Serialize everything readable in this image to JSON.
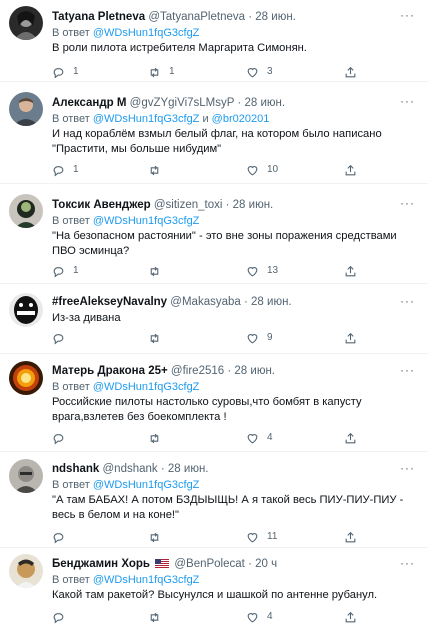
{
  "tweets": [
    {
      "name": "Tatyana Pletneva",
      "handle": "@TatyanaPletneva",
      "dot": "·",
      "time": "28 июн.",
      "reply_prefix": "В ответ ",
      "reply_to": "@WDsHun1fqG3cfgZ",
      "reply_and": "",
      "reply_to2": "",
      "text": "В роли пилота истребителя Маргарита Симонян.",
      "replies": "1",
      "retweets": "1",
      "likes": "3"
    },
    {
      "name": "Александр М",
      "handle": "@gvZYgiVi7sLMsyP",
      "dot": "·",
      "time": "28 июн.",
      "reply_prefix": "В ответ ",
      "reply_to": "@WDsHun1fqG3cfgZ",
      "reply_and": " и ",
      "reply_to2": "@br020201",
      "text": "И над кораблём взмыл белый флаг, на котором было написано \"Прастити, мы больше нибудим\"",
      "replies": "1",
      "retweets": "",
      "likes": "10"
    },
    {
      "name": "Токсик Авенджер",
      "handle": "@sitizen_toxi",
      "dot": "·",
      "time": "28 июн.",
      "reply_prefix": "В ответ ",
      "reply_to": "@WDsHun1fqG3cfgZ",
      "reply_and": "",
      "reply_to2": "",
      "text": "\"На безопасном растоянии\" - это вне зоны поражения средствами ПВО эсминца?",
      "replies": "1",
      "retweets": "",
      "likes": "13"
    },
    {
      "name": "#freeAlekseyNavalny",
      "handle": "@Makasyaba",
      "dot": "·",
      "time": "28 июн.",
      "reply_prefix": "",
      "reply_to": "",
      "reply_and": "",
      "reply_to2": "",
      "text": "Из-за дивана",
      "replies": "",
      "retweets": "",
      "likes": "9"
    },
    {
      "name": "Матерь Дракона 25+",
      "handle": "@fire2516",
      "dot": "·",
      "time": "28 июн.",
      "reply_prefix": "В ответ ",
      "reply_to": "@WDsHun1fqG3cfgZ",
      "reply_and": "",
      "reply_to2": "",
      "text": "Российские пилоты настолько суровы,что бомбят в капусту врага,взлетев без боекомплекта !",
      "replies": "",
      "retweets": "",
      "likes": "4"
    },
    {
      "name": "ndshank",
      "handle": "@ndshank",
      "dot": "·",
      "time": "28 июн.",
      "reply_prefix": "В ответ ",
      "reply_to": "@WDsHun1fqG3cfgZ",
      "reply_and": "",
      "reply_to2": "",
      "text": "\"А там БАБАХ! А потом БЗДЫЫЩЬ! А я такой весь ПИУ-ПИУ-ПИУ - весь в белом и на коне!\"",
      "replies": "",
      "retweets": "",
      "likes": "11"
    },
    {
      "name": "Бенджамин Хорь",
      "handle": "@BenPolecat",
      "dot": "·",
      "time": "20 ч",
      "reply_prefix": "В ответ ",
      "reply_to": "@WDsHun1fqG3cfgZ",
      "reply_and": "",
      "reply_to2": "",
      "text": "Какой там ракетой? Высунулся и шашкой по антенне рубанул.",
      "replies": "",
      "retweets": "",
      "likes": "4"
    }
  ],
  "more_label": "···",
  "colors": {
    "accent": "#1d9bf0",
    "muted": "#536471",
    "text": "#0f1419"
  },
  "icons": [
    "reply-icon",
    "retweet-icon",
    "like-icon",
    "share-icon",
    "more-icon",
    "us-flag-icon"
  ]
}
